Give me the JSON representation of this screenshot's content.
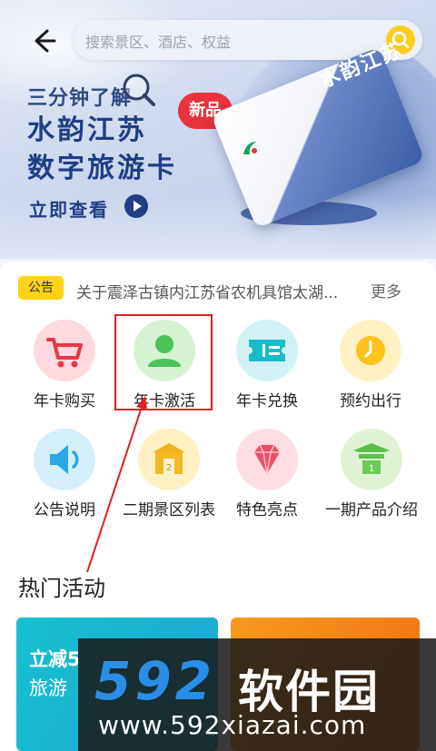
{
  "search": {
    "placeholder": "搜索景区、酒店、权益"
  },
  "banner": {
    "line1": "三分钟了解",
    "line2": "水韵江苏",
    "line3": "数字旅游卡",
    "new_tag": "新品",
    "cta": "立即查看",
    "card_text": "水韵江苏"
  },
  "notice": {
    "badge": "公告",
    "text": "关于震泽古镇内江苏省农机具馆太湖...",
    "more": "更多"
  },
  "tiles": [
    {
      "label": "年卡购买",
      "icon": "shopping-cart-icon",
      "color": "#ffd9de"
    },
    {
      "label": "年卡激活",
      "icon": "user-icon",
      "color": "#d6f2d3"
    },
    {
      "label": "年卡兑换",
      "icon": "ticket-icon",
      "color": "#d2f1f4"
    },
    {
      "label": "预约出行",
      "icon": "clock-icon",
      "color": "#fff1c4"
    },
    {
      "label": "公告说明",
      "icon": "speaker-icon",
      "color": "#d4eefa"
    },
    {
      "label": "二期景区列表",
      "icon": "gate-icon",
      "color": "#fff0c2"
    },
    {
      "label": "特色亮点",
      "icon": "diamond-icon",
      "color": "#ffdde2"
    },
    {
      "label": "一期产品介绍",
      "icon": "pavilion-icon",
      "color": "#dff3d4"
    }
  ],
  "section": {
    "hot_title": "热门活动"
  },
  "promos": [
    {
      "line1": "立减5",
      "line2": "旅游"
    },
    {
      "line1": "",
      "line2": ""
    }
  ],
  "watermark": {
    "logo": "592",
    "name": "软件园",
    "url": "www.592xiazai.com"
  },
  "colors": {
    "accent_yellow": "#ffcc1f",
    "brand_blue": "#1f3e86",
    "highlight_red": "#e02020"
  }
}
